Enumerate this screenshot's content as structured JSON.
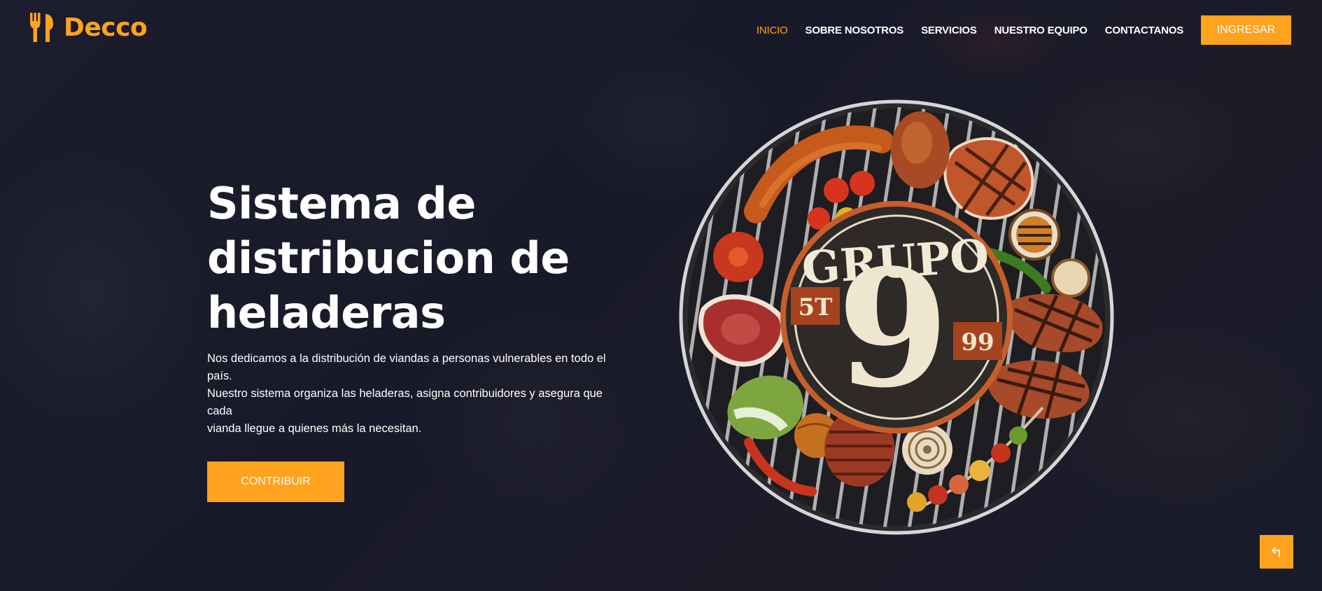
{
  "brand": {
    "name": "Decco",
    "icon": "utensils-icon",
    "accent_color": "#ffa21d"
  },
  "nav": {
    "items": [
      {
        "label": "INICIO",
        "active": true
      },
      {
        "label": "SOBRE NOSOTROS",
        "active": false
      },
      {
        "label": "SERVICIOS",
        "active": false
      },
      {
        "label": "NUESTRO EQUIPO",
        "active": false
      },
      {
        "label": "CONTACTANOS",
        "active": false
      }
    ],
    "login_label": "INGRESAR"
  },
  "hero": {
    "title_line1": "Sistema de",
    "title_line2": "distribucion de",
    "title_line3": "heladeras",
    "description_line1": "Nos dedicamos a la distribución de viandas a personas vulnerables en todo el país.",
    "description_line2": "Nuestro sistema organiza las heladeras, asigna contribuidores y asegura que cada",
    "description_line3": "vianda llegue a quienes más la necesitan.",
    "cta_label": "CONTRIBUIR"
  },
  "grill_logo": {
    "word": "GRUPO",
    "number": "9",
    "left_badge": "5T",
    "right_badge": "99"
  },
  "back_to_top": {
    "icon": "arrow-return-icon"
  }
}
